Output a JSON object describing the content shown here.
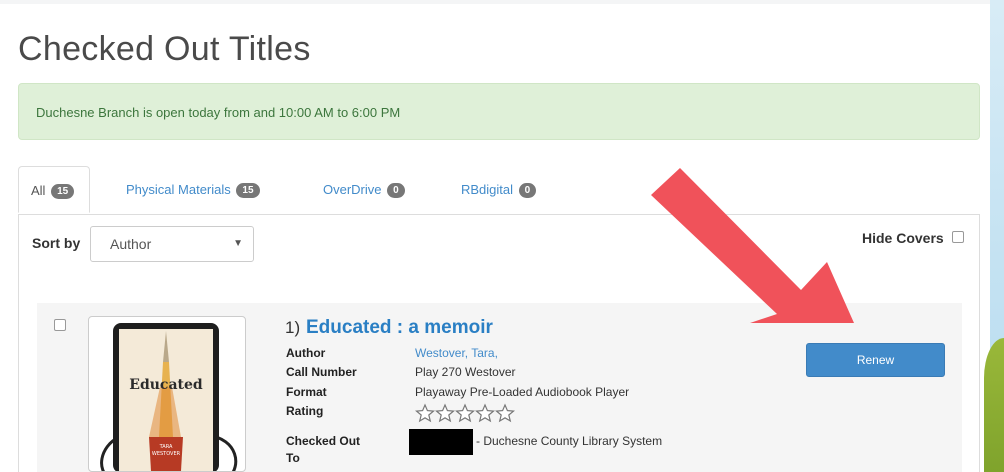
{
  "page": {
    "title": "Checked Out Titles",
    "alert": "Duchesne Branch is open today from and 10:00 AM to 6:00 PM"
  },
  "tabs": [
    {
      "label": "All",
      "count": "15",
      "active": true
    },
    {
      "label": "Physical Materials",
      "count": "15",
      "active": false
    },
    {
      "label": "OverDrive",
      "count": "0",
      "active": false
    },
    {
      "label": "RBdigital",
      "count": "0",
      "active": false
    }
  ],
  "toolbar": {
    "sort_label": "Sort by",
    "sort_value": "Author",
    "hide_covers_label": "Hide Covers"
  },
  "item": {
    "number": "1)",
    "title": "Educated : a memoir",
    "author_label": "Author",
    "author": "Westover, Tara,",
    "call_number_label": "Call Number",
    "call_number": "Play 270 Westover",
    "format_label": "Format",
    "format": "Playaway Pre-Loaded Audiobook Player",
    "rating_label": "Rating",
    "rating_stars": 0,
    "rating_max": 5,
    "checked_out_label": "Checked Out",
    "checked_out_label2": "To",
    "checked_out_to": "- Duchesne County Library System",
    "renew_label": "Renew"
  },
  "cover": {
    "title_text": "Educated",
    "author_text": "TARA\nWESTOVER"
  },
  "colors": {
    "accent": "#428bca",
    "link": "#2a7fc4",
    "alert_bg": "#dff0d8",
    "alert_text": "#3c763d",
    "annotation_arrow": "#f0525a"
  }
}
